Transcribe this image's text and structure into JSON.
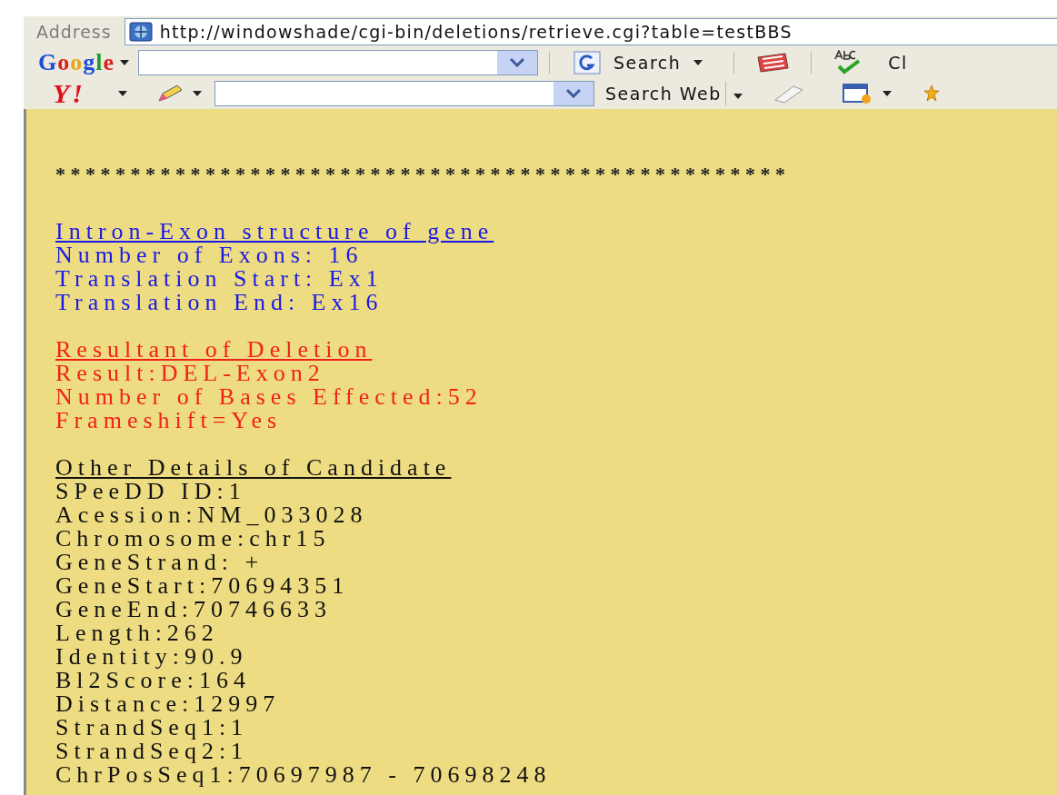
{
  "address_bar": {
    "label": "Address",
    "url": "http://windowshade/cgi-bin/deletions/retrieve.cgi?table=testBBS"
  },
  "google_toolbar": {
    "logo": "Google",
    "search_button": "Search",
    "cut_label": "Cl"
  },
  "yahoo_toolbar": {
    "logo": "Y!",
    "search_button": "Search Web"
  },
  "page": {
    "separator": "* * * * * * * * * * * * * * * * * * * * * * * * * * * * * * * * * * * * * * * * * * * * * * * * *",
    "sections": [
      {
        "kind": "structure",
        "heading": "Intron-Exon structure of gene",
        "lines": [
          "Number of Exons: 16",
          "Translation Start: Ex1",
          "Translation End: Ex16"
        ]
      },
      {
        "kind": "deletion",
        "heading": "Resultant of Deletion",
        "lines": [
          "Result:DEL-Exon2",
          "Number of Bases Effected:52",
          "Frameshift=Yes"
        ]
      },
      {
        "kind": "details",
        "heading": "Other Details of Candidate",
        "lines": [
          "SPeeDD ID:1",
          "Acession:NM_033028",
          "Chromosome:chr15",
          "GeneStrand: +",
          "GeneStart:70694351",
          "GeneEnd:70746633",
          "Length:262",
          "Identity:90.9",
          "Bl2Score:164",
          "Distance:12997",
          "StrandSeq1:1",
          "StrandSeq2:1",
          "ChrPosSeq1:70697987 - 70698248"
        ]
      }
    ]
  }
}
